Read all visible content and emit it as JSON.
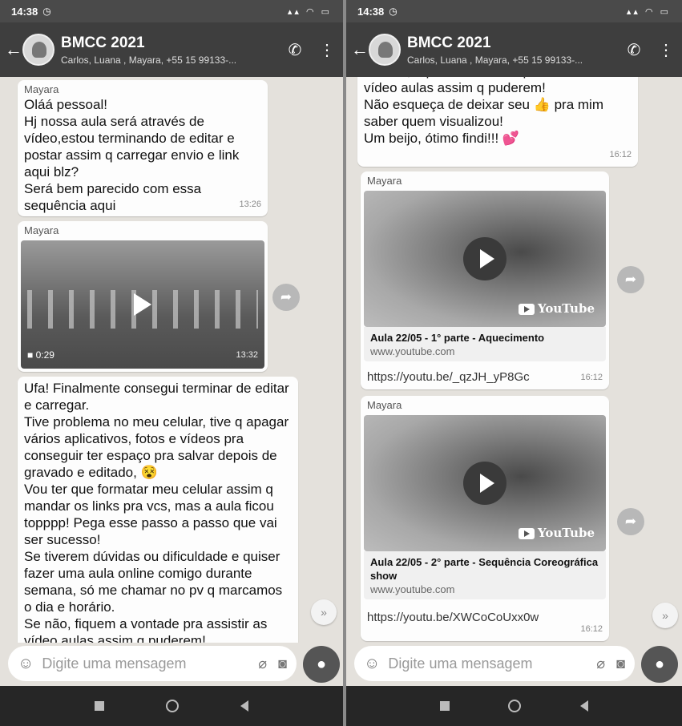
{
  "left": {
    "status": {
      "time": "14:38",
      "alarm_icon": "alarm-icon",
      "system_icons": "signal-icon wifi-icon battery-icon"
    },
    "header": {
      "title": "BMCC 2021",
      "participants": "Carlos, Luana , Mayara, +55 15 99133-..."
    },
    "messages": [
      {
        "sender": "Mayara",
        "text": "Oláá pessoal!\nHj nossa aula será através de vídeo,estou terminando de editar e postar assim q carregar envio e link aqui blz?\nSerá bem parecido com essa sequência aqui",
        "time": "13:26"
      },
      {
        "sender": "Mayara",
        "video_duration": "0:29",
        "time": "13:32"
      },
      {
        "text": "Ufa! Finalmente consegui terminar de editar e carregar.\nTive problema no meu celular, tive q apagar vários aplicativos, fotos e vídeos pra conseguir ter espaço pra salvar depois de gravado e editado, 😵\nVou ter que formatar meu celular assim q mandar os links pra vcs, mas a aula ficou topppp! Pega esse passo a passo que vai ser sucesso!\nSe tiverem dúvidas ou dificuldade e quiser fazer uma aula online comigo durante semana, só me chamar no pv q marcamos o dia e horário.\nSe não, fiquem a vontade pra assistir as vídeo aulas assim q puderem!"
      }
    ],
    "composer": {
      "placeholder": "Digite uma mensagem"
    }
  },
  "right": {
    "status": {
      "time": "14:38",
      "alarm_icon": "alarm-icon",
      "system_icons": "signal-icon wifi-icon battery-icon"
    },
    "header": {
      "title": "BMCC 2021",
      "participants": "Carlos, Luana , Mayara, +55 15 99133-..."
    },
    "messages": [
      {
        "text": "Se não, fiquem a vontade pra assistir as vídeo aulas assim q puderem!\nNão esqueça de deixar seu 👍 pra mim saber quem visualizou!\nUm beijo, ótimo findi!!! 💕",
        "time": "16:12"
      },
      {
        "sender": "Mayara",
        "link_title": "Aula 22/05 - 1° parte - Aquecimento",
        "link_domain": "www.youtube.com",
        "url": "https://youtu.be/_qzJH_yP8Gc",
        "time": "16:12",
        "yt_label": "YouTube"
      },
      {
        "sender": "Mayara",
        "link_title": "Aula 22/05 - 2° parte - Sequência Coreográfica show",
        "link_domain": "www.youtube.com",
        "url": "https://youtu.be/XWCoCoUxx0w",
        "time": "16:12",
        "yt_label": "YouTube"
      }
    ],
    "composer": {
      "placeholder": "Digite uma mensagem"
    }
  },
  "icons": {
    "back": "←",
    "call": "✆",
    "menu": "⋮",
    "forward": "➦",
    "scroll": "»",
    "emoji": "☺",
    "clip": "⌀",
    "camera": "◙",
    "mic": "🎤",
    "video_cam": "■"
  }
}
